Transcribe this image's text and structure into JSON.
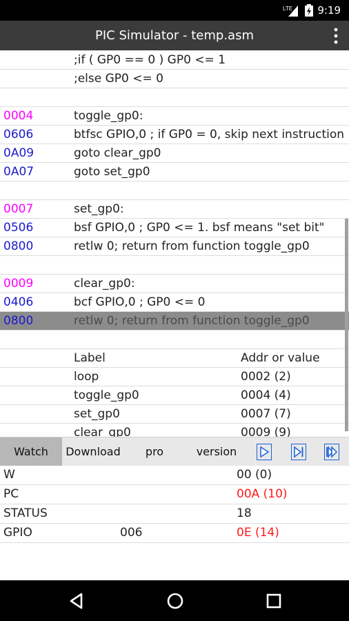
{
  "status_bar": {
    "time": "9:19",
    "network": "LTE"
  },
  "app_bar": {
    "title": "PIC Simulator - temp.asm"
  },
  "code_rows": [
    {
      "addr": "",
      "text": ";if ( GP0 == 0 ) GP0 <= 1",
      "addr_color": "#000000"
    },
    {
      "addr": "",
      "text": ";else GP0 <= 0",
      "addr_color": "#000000"
    },
    {
      "addr": "",
      "text": "",
      "addr_color": "#000000"
    },
    {
      "addr": "0004",
      "text": "toggle_gp0:",
      "addr_color": "#ff00ff"
    },
    {
      "addr": "0606",
      "text": "btfsc GPIO,0 ; if GP0 = 0, skip next instruction",
      "addr_color": "#1a1acc"
    },
    {
      "addr": "0A09",
      "text": "goto clear_gp0",
      "addr_color": "#1a1acc"
    },
    {
      "addr": "0A07",
      "text": "goto set_gp0",
      "addr_color": "#1a1acc"
    },
    {
      "addr": "",
      "text": "",
      "addr_color": "#000000"
    },
    {
      "addr": "0007",
      "text": "set_gp0:",
      "addr_color": "#ff00ff"
    },
    {
      "addr": "0506",
      "text": "bsf GPIO,0 ; GP0 <= 1. bsf means \"set bit\"",
      "addr_color": "#1a1acc"
    },
    {
      "addr": "0800",
      "text": "retlw 0; return from function toggle_gp0",
      "addr_color": "#1a1acc"
    },
    {
      "addr": "",
      "text": "",
      "addr_color": "#000000"
    },
    {
      "addr": "0009",
      "text": "clear_gp0:",
      "addr_color": "#ff00ff"
    },
    {
      "addr": "0406",
      "text": "bcf GPIO,0 ; GP0 <= 0",
      "addr_color": "#1a1acc"
    },
    {
      "addr": "0800",
      "text": "retlw 0; return from function toggle_gp0",
      "addr_color": "#1a1acc"
    },
    {
      "addr": "",
      "text": "",
      "addr_color": "#000000"
    }
  ],
  "label_table": {
    "header": {
      "label": "Label",
      "value": "Addr or value"
    },
    "rows": [
      {
        "label": "loop",
        "value": "0002 (2)"
      },
      {
        "label": "toggle_gp0",
        "value": "0004 (4)"
      },
      {
        "label": "set_gp0",
        "value": "0007 (7)"
      },
      {
        "label": "clear_gp0",
        "value": "0009 (9)"
      }
    ]
  },
  "tabs": [
    {
      "label": "Watch"
    },
    {
      "label": "Download"
    },
    {
      "label": "pro"
    },
    {
      "label": "version"
    }
  ],
  "controls": [
    "play-icon",
    "step-icon",
    "fast-forward-icon"
  ],
  "watch": [
    {
      "name": "W",
      "mid": "",
      "value": "00 (0)",
      "changed": false
    },
    {
      "name": "PC",
      "mid": "",
      "value": "00A (10)",
      "changed": true
    },
    {
      "name": "STATUS",
      "mid": "",
      "value": "18",
      "changed": false
    },
    {
      "name": "GPIO",
      "mid": "006",
      "value": "0E (14)",
      "changed": true
    }
  ],
  "colors": {
    "accent": "#1a1acc",
    "label": "#ff00ff",
    "changed": "#ff1a1a",
    "highlight": "#8c8c8c"
  }
}
